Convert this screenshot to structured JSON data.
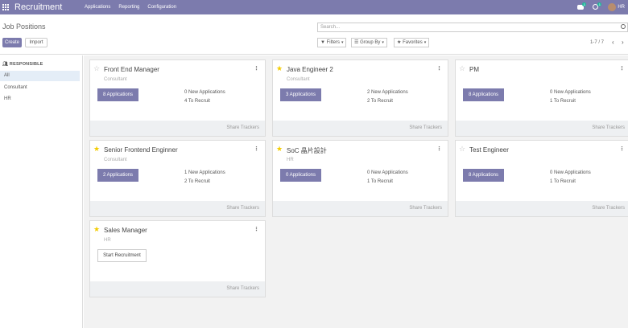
{
  "navbar": {
    "brand": "Recruitment",
    "menu": [
      "Applications",
      "Reporting",
      "Configuration"
    ],
    "messages_count": "1",
    "activities_count": "1",
    "user": "HR"
  },
  "control": {
    "title": "Job Positions",
    "create_label": "Create",
    "import_label": "Import",
    "search_placeholder": "Search...",
    "filters_label": "Filters",
    "groupby_label": "Group By",
    "favorites_label": "Favorites",
    "pager": "1-7 / 7"
  },
  "sidebar": {
    "heading": "RESPONSIBLE",
    "items": [
      {
        "label": "All",
        "active": true
      },
      {
        "label": "Consultant",
        "active": false
      },
      {
        "label": "HR",
        "active": false
      }
    ]
  },
  "colors": {
    "brand": "#7c7bad",
    "star_on": "#f3cc00",
    "active_filter_bg": "#e4edf7"
  },
  "jobs": [
    {
      "title": "Front End Manager",
      "favorite": false,
      "responsible": "Consultant",
      "button": "8 Applications",
      "new_apps": "0 New Applications",
      "to_recruit": "4 To Recruit",
      "footer": "Share Trackers"
    },
    {
      "title": "Java Engineer 2",
      "favorite": true,
      "responsible": "Consultant",
      "button": "3 Applications",
      "new_apps": "2 New Applications",
      "to_recruit": "2 To Recruit",
      "footer": "Share Trackers"
    },
    {
      "title": "PM",
      "favorite": false,
      "responsible": "",
      "button": "8 Applications",
      "new_apps": "0 New Applications",
      "to_recruit": "1 To Recruit",
      "footer": "Share Trackers"
    },
    {
      "title": "Senior Frontend Enginner",
      "favorite": true,
      "responsible": "Consultant",
      "button": "2 Applications",
      "new_apps": "1 New Applications",
      "to_recruit": "2 To Recruit",
      "footer": "Share Trackers"
    },
    {
      "title": "SoC 晶片設計",
      "favorite": true,
      "responsible": "HR",
      "button": "0 Applications",
      "new_apps": "0 New Applications",
      "to_recruit": "1 To Recruit",
      "footer": "Share Trackers"
    },
    {
      "title": "Test Engineer",
      "favorite": false,
      "responsible": "",
      "button": "8 Applications",
      "new_apps": "0 New Applications",
      "to_recruit": "1 To Recruit",
      "footer": "Share Trackers"
    },
    {
      "title": "Sales Manager",
      "favorite": true,
      "responsible": "HR",
      "start_button": "Start Recruitment",
      "footer": "Share Trackers"
    }
  ]
}
